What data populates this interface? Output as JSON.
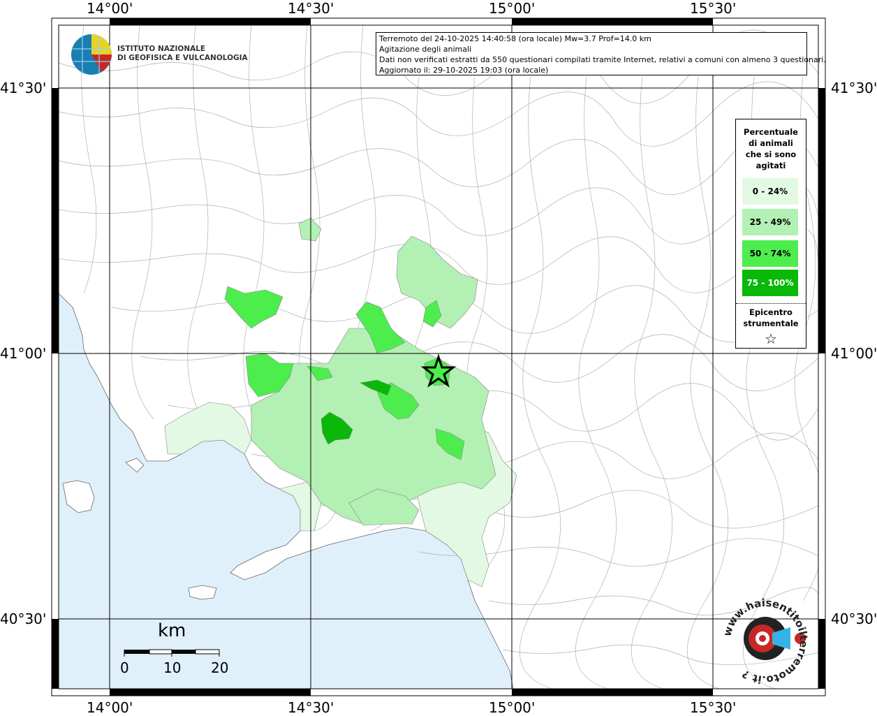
{
  "map": {
    "title_lines": [
      "Terremoto del 24-10-2025 14:40:58 (ora locale) Mw=3.7 Prof=14.0 km",
      "Agitazione degli animali",
      "Dati non verificati estratti da 550 questionari compilati tramite Internet, relativi a comuni con almeno 3 questionari.",
      "Aggiornato il: 29-10-2025 19:03 (ora locale)"
    ],
    "institute": [
      "ISTITUTO NAZIONALE",
      "DI GEOFISICA E VULCANOLOGIA"
    ],
    "lon_labels": [
      "14°00'",
      "14°30'",
      "15°00'",
      "15°30'"
    ],
    "lat_labels": [
      "41°30'",
      "41°00'",
      "40°30'"
    ],
    "scale": {
      "unit": "km",
      "ticks": [
        "0",
        "10",
        "20"
      ]
    },
    "legend": {
      "title": [
        "Percentuale",
        "di animali",
        "che si sono",
        "agitati"
      ],
      "classes": [
        {
          "label": "0 - 24%",
          "color": "#e3f9e3"
        },
        {
          "label": "25 - 49%",
          "color": "#b3f0b3"
        },
        {
          "label": "50 - 74%",
          "color": "#4ded4d"
        },
        {
          "label": "75 - 100%",
          "color": "#09b809"
        }
      ],
      "epicenter_label": [
        "Epicentro",
        "strumentale"
      ],
      "epicenter_symbol": "☆"
    },
    "sea_color": "#dff0fb",
    "site_logo_text": "www.haisentitoilterremoto.it ?"
  }
}
